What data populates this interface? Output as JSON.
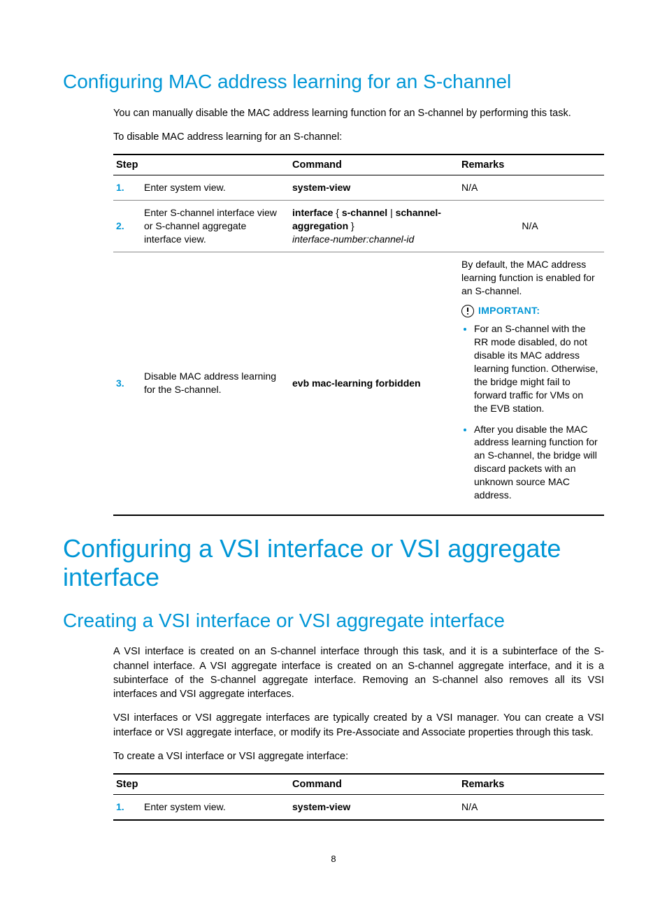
{
  "section1": {
    "heading": "Configuring MAC address learning for an S-channel",
    "para1": "You can manually disable the MAC address learning function for an S-channel by performing this task.",
    "para2": "To disable MAC address learning for an S-channel:",
    "table": {
      "headers": {
        "step": "Step",
        "command": "Command",
        "remarks": "Remarks"
      },
      "rows": [
        {
          "num": "1.",
          "step": "Enter system view.",
          "cmd_bold": "system-view",
          "remarks_plain": "N/A"
        },
        {
          "num": "2.",
          "step": "Enter S-channel interface view or S-channel aggregate interface view.",
          "cmd_prefix": "interface",
          "cmd_opt1": "s-channel",
          "cmd_opt2": "schannel-aggregation",
          "cmd_italic": "interface-number:channel-id",
          "remarks_plain": "N/A"
        },
        {
          "num": "3.",
          "step": "Disable MAC address learning for the S-channel.",
          "cmd_bold": "evb mac-learning forbidden",
          "remarks_intro": "By default, the MAC address learning function is enabled for an S-channel.",
          "important_label": "IMPORTANT:",
          "bullets": [
            "For an S-channel with the RR mode disabled, do not disable its MAC address learning function. Otherwise, the bridge might fail to forward traffic for VMs on the EVB station.",
            "After you disable the MAC address learning function for an S-channel, the bridge will discard packets with an unknown source MAC address."
          ]
        }
      ]
    }
  },
  "section2": {
    "heading": "Configuring a VSI interface or VSI aggregate interface",
    "subheading": "Creating a VSI interface or VSI aggregate interface",
    "para1": "A VSI interface is created on an S-channel interface through this task, and it is a subinterface of the S-channel interface. A VSI aggregate interface is created on an S-channel aggregate interface, and it is a subinterface of the S-channel aggregate interface. Removing an S-channel also removes all its VSI interfaces and VSI aggregate interfaces.",
    "para2": "VSI interfaces or VSI aggregate interfaces are typically created by a VSI manager. You can create a VSI interface or VSI aggregate interface, or modify its Pre-Associate and Associate properties through this task.",
    "para3": "To create a VSI interface or VSI aggregate interface:",
    "table": {
      "headers": {
        "step": "Step",
        "command": "Command",
        "remarks": "Remarks"
      },
      "rows": [
        {
          "num": "1.",
          "step": "Enter system view.",
          "cmd_bold": "system-view",
          "remarks_plain": "N/A"
        }
      ]
    }
  },
  "page_number": "8"
}
